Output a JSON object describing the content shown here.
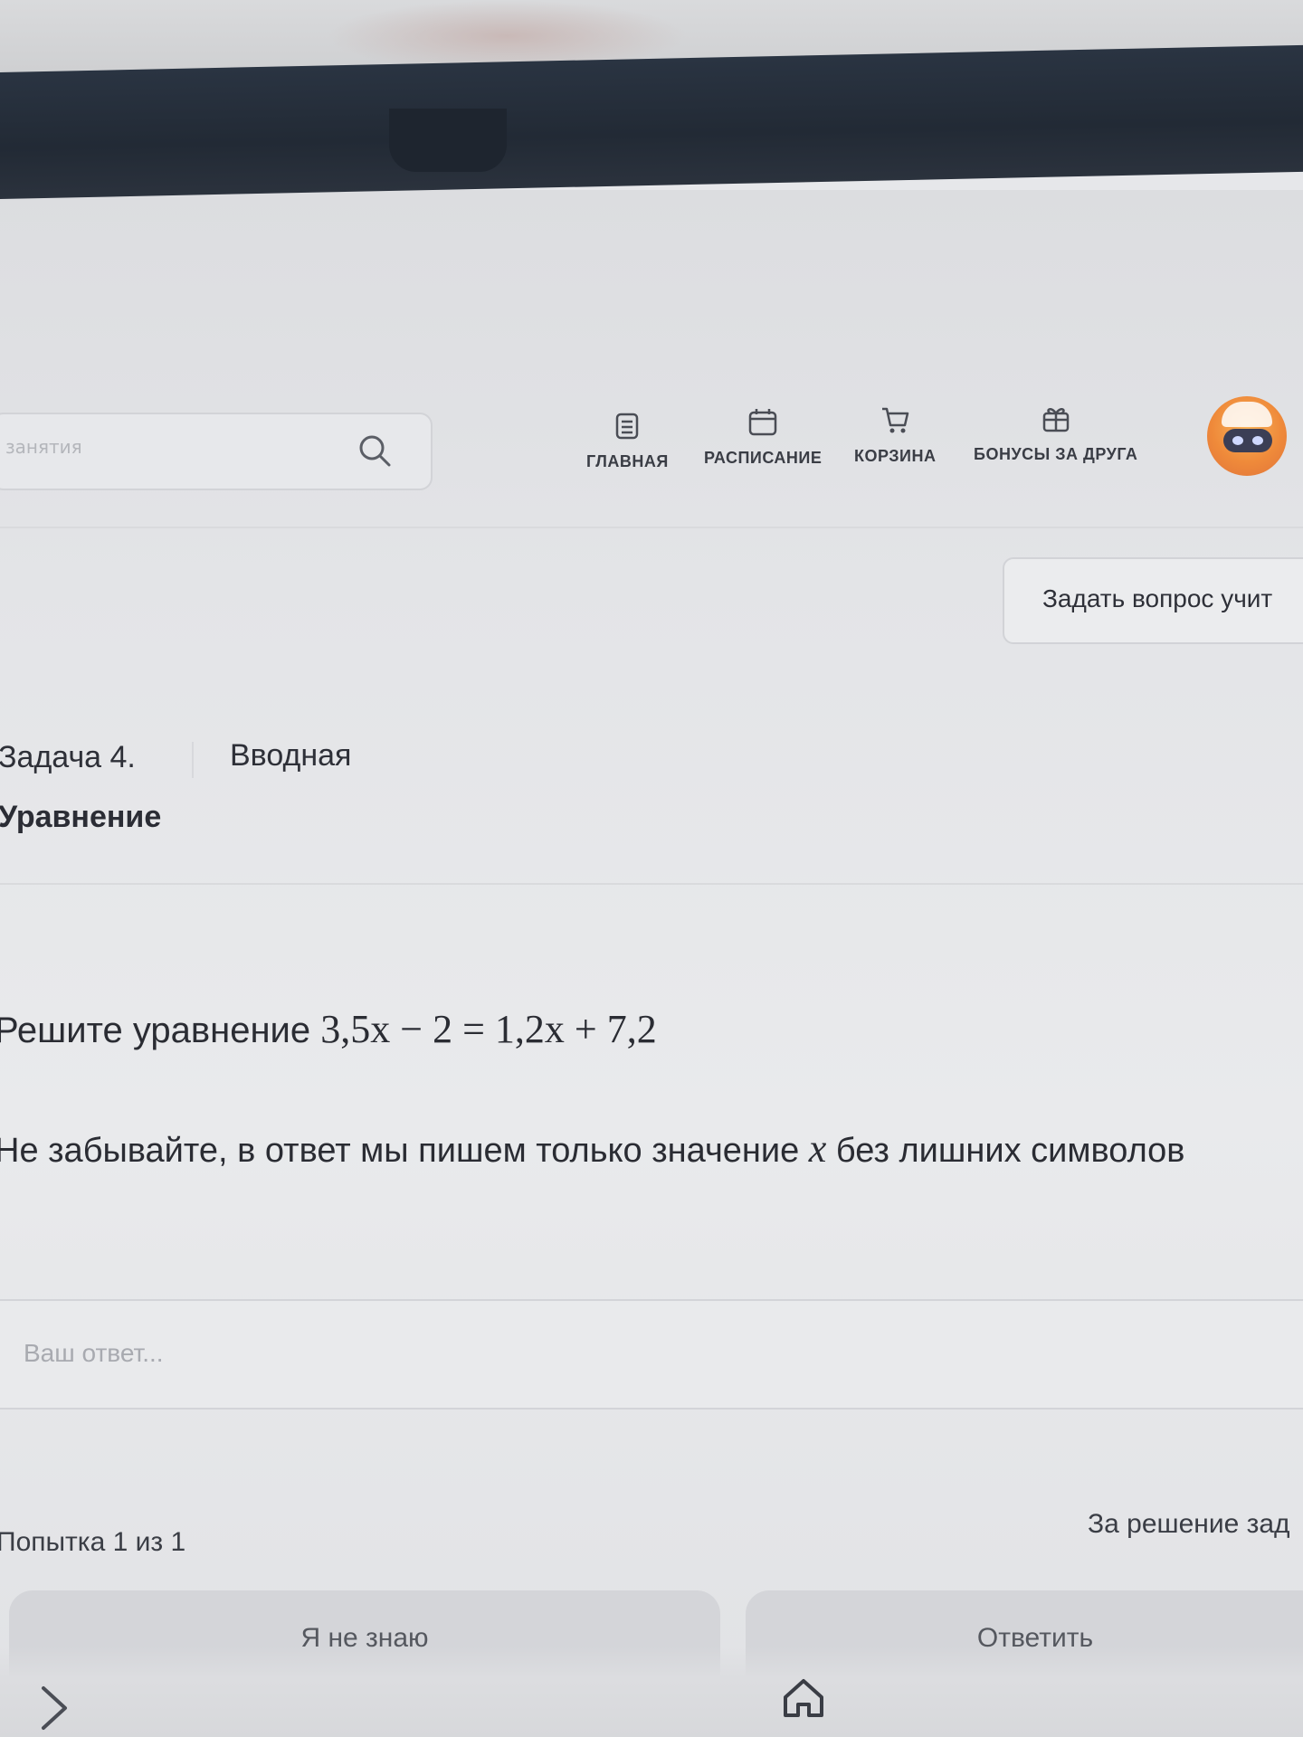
{
  "header": {
    "search_placeholder": "занятия",
    "nav": [
      {
        "label": "ГЛАВНАЯ",
        "icon": "document-list-icon"
      },
      {
        "label": "РАСПИСАНИЕ",
        "icon": "calendar-icon"
      },
      {
        "label": "КОРЗИНА",
        "icon": "cart-icon"
      },
      {
        "label": "БОНУСЫ ЗА ДРУГА",
        "icon": "gift-icon"
      }
    ],
    "avatar_icon": "avatar-icon"
  },
  "actions": {
    "ask_teacher": "Задать вопрос учит"
  },
  "task": {
    "number": "Задача 4.",
    "type": "Вводная",
    "title": "Уравнение",
    "problem_prefix": "Решите уравнение ",
    "equation": "3,5x − 2 = 1,2x + 7,2",
    "hint_prefix": "Не забывайте, в ответ мы пишем только значение ",
    "hint_var": "x",
    "hint_suffix": " без лишних символов"
  },
  "answer": {
    "placeholder": "Ваш ответ..."
  },
  "footer": {
    "attempts": "Попытка 1 из 1",
    "reward": "За решение зад",
    "dont_know": "Я не знаю",
    "submit": "Ответить"
  },
  "colors": {
    "text": "#2a2c33",
    "background": "#e6e7ea",
    "button": "#d4d5d9",
    "bezel": "#222a35"
  }
}
